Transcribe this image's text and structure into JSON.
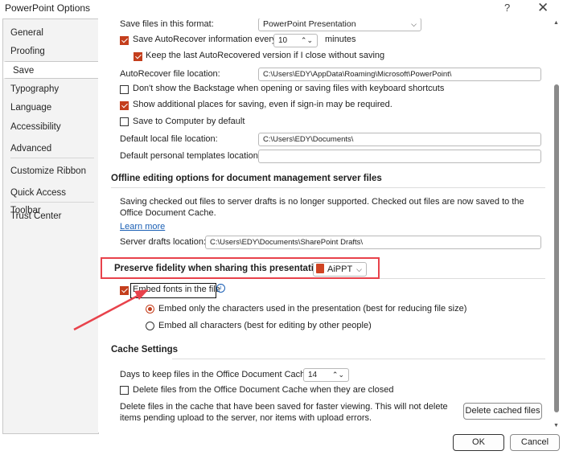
{
  "window": {
    "title": "PowerPoint Options",
    "help": "?",
    "close": "✕"
  },
  "sidebar": {
    "items": [
      {
        "label": "General"
      },
      {
        "label": "Proofing"
      },
      {
        "label": "Save"
      },
      {
        "label": "Typography"
      },
      {
        "label": "Language"
      },
      {
        "label": "Accessibility"
      },
      {
        "label": "Advanced"
      },
      {
        "label": "Customize Ribbon"
      },
      {
        "label": "Quick Access Toolbar"
      },
      {
        "label": "Trust Center"
      }
    ],
    "active": "Save"
  },
  "save": {
    "format_label": "Save files in this format:",
    "format_value": "PowerPoint Presentation",
    "autorecover_label": "Save AutoRecover information every",
    "autorecover_minutes": "10",
    "minutes_label": "minutes",
    "keep_last_label": "Keep the last AutoRecovered version if I close without saving",
    "autorecover_location_label": "AutoRecover file location:",
    "autorecover_location_value": "C:\\Users\\EDY\\AppData\\Roaming\\Microsoft\\PowerPoint\\",
    "dont_show_backstage_label": "Don't show the Backstage when opening or saving files with keyboard shortcuts",
    "show_additional_places_label": "Show additional places for saving, even if sign-in may be required.",
    "save_to_computer_label": "Save to Computer by default",
    "default_local_label": "Default local file location:",
    "default_local_value": "C:\\Users\\EDY\\Documents\\",
    "default_templates_label": "Default personal templates location:",
    "default_templates_value": ""
  },
  "offline": {
    "heading": "Offline editing options for document management server files",
    "description": "Saving checked out files to server drafts is no longer supported. Checked out files are now saved to the Office Document Cache.",
    "learn_more": "Learn more",
    "server_drafts_label": "Server drafts location:",
    "server_drafts_value": "C:\\Users\\EDY\\Documents\\SharePoint Drafts\\"
  },
  "fidelity": {
    "heading": "Preserve fidelity when sharing this presentation:",
    "presentation": "AiPPT",
    "embed_fonts_label": "Embed fonts in the file",
    "info_icon": "i",
    "embed_only_label": "Embed only the characters used in the presentation (best for reducing file size)",
    "embed_all_label": "Embed all characters (best for editing by other people)"
  },
  "cache": {
    "heading": "Cache Settings",
    "days_label": "Days to keep files in the Office Document Cache:",
    "days_value": "14",
    "delete_on_close_label": "Delete files from the Office Document Cache when they are closed",
    "delete_desc": "Delete files in the cache that have been saved for faster viewing. This will not delete items pending upload to the server, nor items with upload errors.",
    "delete_button": "Delete cached files"
  },
  "footer": {
    "ok": "OK",
    "cancel": "Cancel"
  },
  "colors": {
    "accent": "#c43e1c",
    "highlight_box": "#e8424b",
    "link": "#1a5fb4"
  }
}
